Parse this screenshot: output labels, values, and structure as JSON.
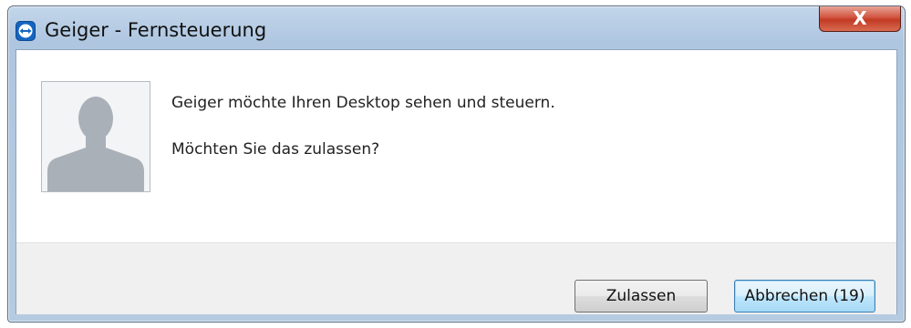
{
  "window": {
    "title": "Geiger - Fernsteuerung",
    "close_label": "X",
    "icon": "teamviewer-arrows-icon"
  },
  "dialog": {
    "avatar_icon": "user-silhouette-icon",
    "message_line1": "Geiger möchte Ihren Desktop sehen und steuern.",
    "message_line2": "Möchten Sie das zulassen?"
  },
  "buttons": {
    "allow_label": "Zulassen",
    "cancel_label": "Abbrechen (19)"
  },
  "colors": {
    "titlebar": "#aec6e0",
    "close_button": "#c23a23",
    "footer": "#f0f0f0",
    "default_button_highlight": "#3c7fb1"
  }
}
